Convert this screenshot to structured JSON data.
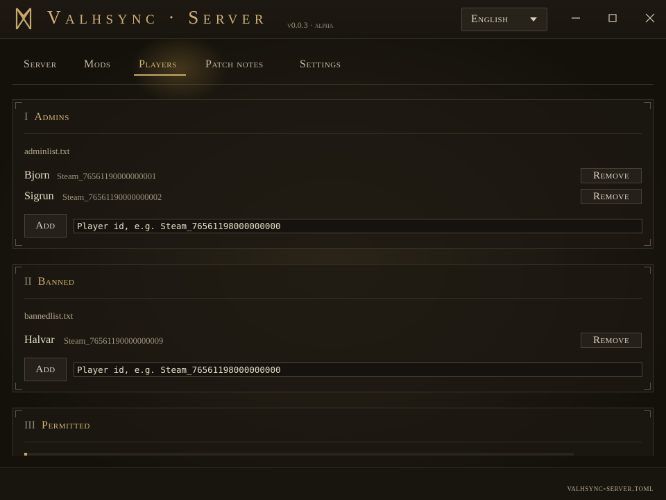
{
  "app": {
    "title": "Valhsync · Server",
    "version": "v0.0.3 · alpha",
    "logo_icon": "rune-logo-icon",
    "accent_color": "#c9a868"
  },
  "language": {
    "selected": "English"
  },
  "window_controls": [
    "minimize-icon",
    "maximize-icon",
    "close-icon"
  ],
  "tabs": [
    {
      "label": "Server",
      "active": false
    },
    {
      "label": "Mods",
      "active": false
    },
    {
      "label": "Players",
      "active": true
    },
    {
      "label": "Patch notes",
      "active": false
    },
    {
      "label": "Settings",
      "active": false
    }
  ],
  "admins": {
    "numeral": "I",
    "title": "Admins",
    "file": "adminlist.txt",
    "players": [
      {
        "name": "Bjorn",
        "id": "Steam_76561190000000001"
      },
      {
        "name": "Sigrun",
        "id": "Steam_76561190000000002"
      }
    ],
    "remove_label": "Remove",
    "add_label": "Add",
    "input_placeholder": "Player id, e.g. Steam_76561198000000000"
  },
  "banned": {
    "numeral": "II",
    "title": "Banned",
    "file": "bannedlist.txt",
    "players": [
      {
        "name": "Halvar",
        "id": "Steam_76561190000000009"
      }
    ],
    "remove_label": "Remove",
    "add_label": "Add",
    "input_placeholder": "Player id, e.g. Steam_76561198000000000"
  },
  "permitted": {
    "numeral": "III",
    "title": "Permitted"
  },
  "footer": {
    "config_file": "valhsync-server.toml"
  }
}
